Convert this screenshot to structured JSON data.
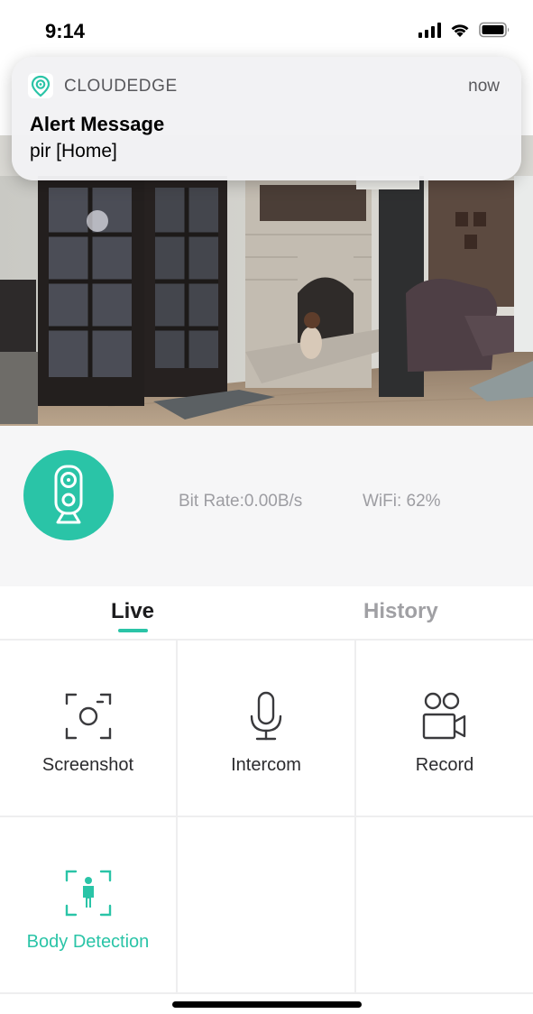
{
  "status_bar": {
    "time": "9:14",
    "icons": [
      "cellular-signal-icon",
      "wifi-icon",
      "battery-icon"
    ]
  },
  "notification": {
    "app_icon": "cloudedge-logo-icon",
    "app_name": "CLOUDEDGE",
    "time": "now",
    "title": "Alert Message",
    "body": "pir [Home]"
  },
  "camera_feed": {
    "content": "live-camera-image"
  },
  "device_info": {
    "icon": "camera-icon",
    "bit_rate": "Bit Rate:0.00B/s",
    "wifi": "WiFi: 62%"
  },
  "tabs": [
    {
      "label": "Live",
      "active": true
    },
    {
      "label": "History",
      "active": false
    }
  ],
  "actions": [
    {
      "label": "Screenshot",
      "icon": "screenshot-icon"
    },
    {
      "label": "Intercom",
      "icon": "microphone-icon"
    },
    {
      "label": "Record",
      "icon": "video-record-icon"
    },
    {
      "label": "Body Detection",
      "icon": "body-detection-icon",
      "active": true
    }
  ],
  "colors": {
    "accent": "#2ac4a7",
    "text_muted": "#9d9da2",
    "panel_bg": "#f6f6f7"
  }
}
